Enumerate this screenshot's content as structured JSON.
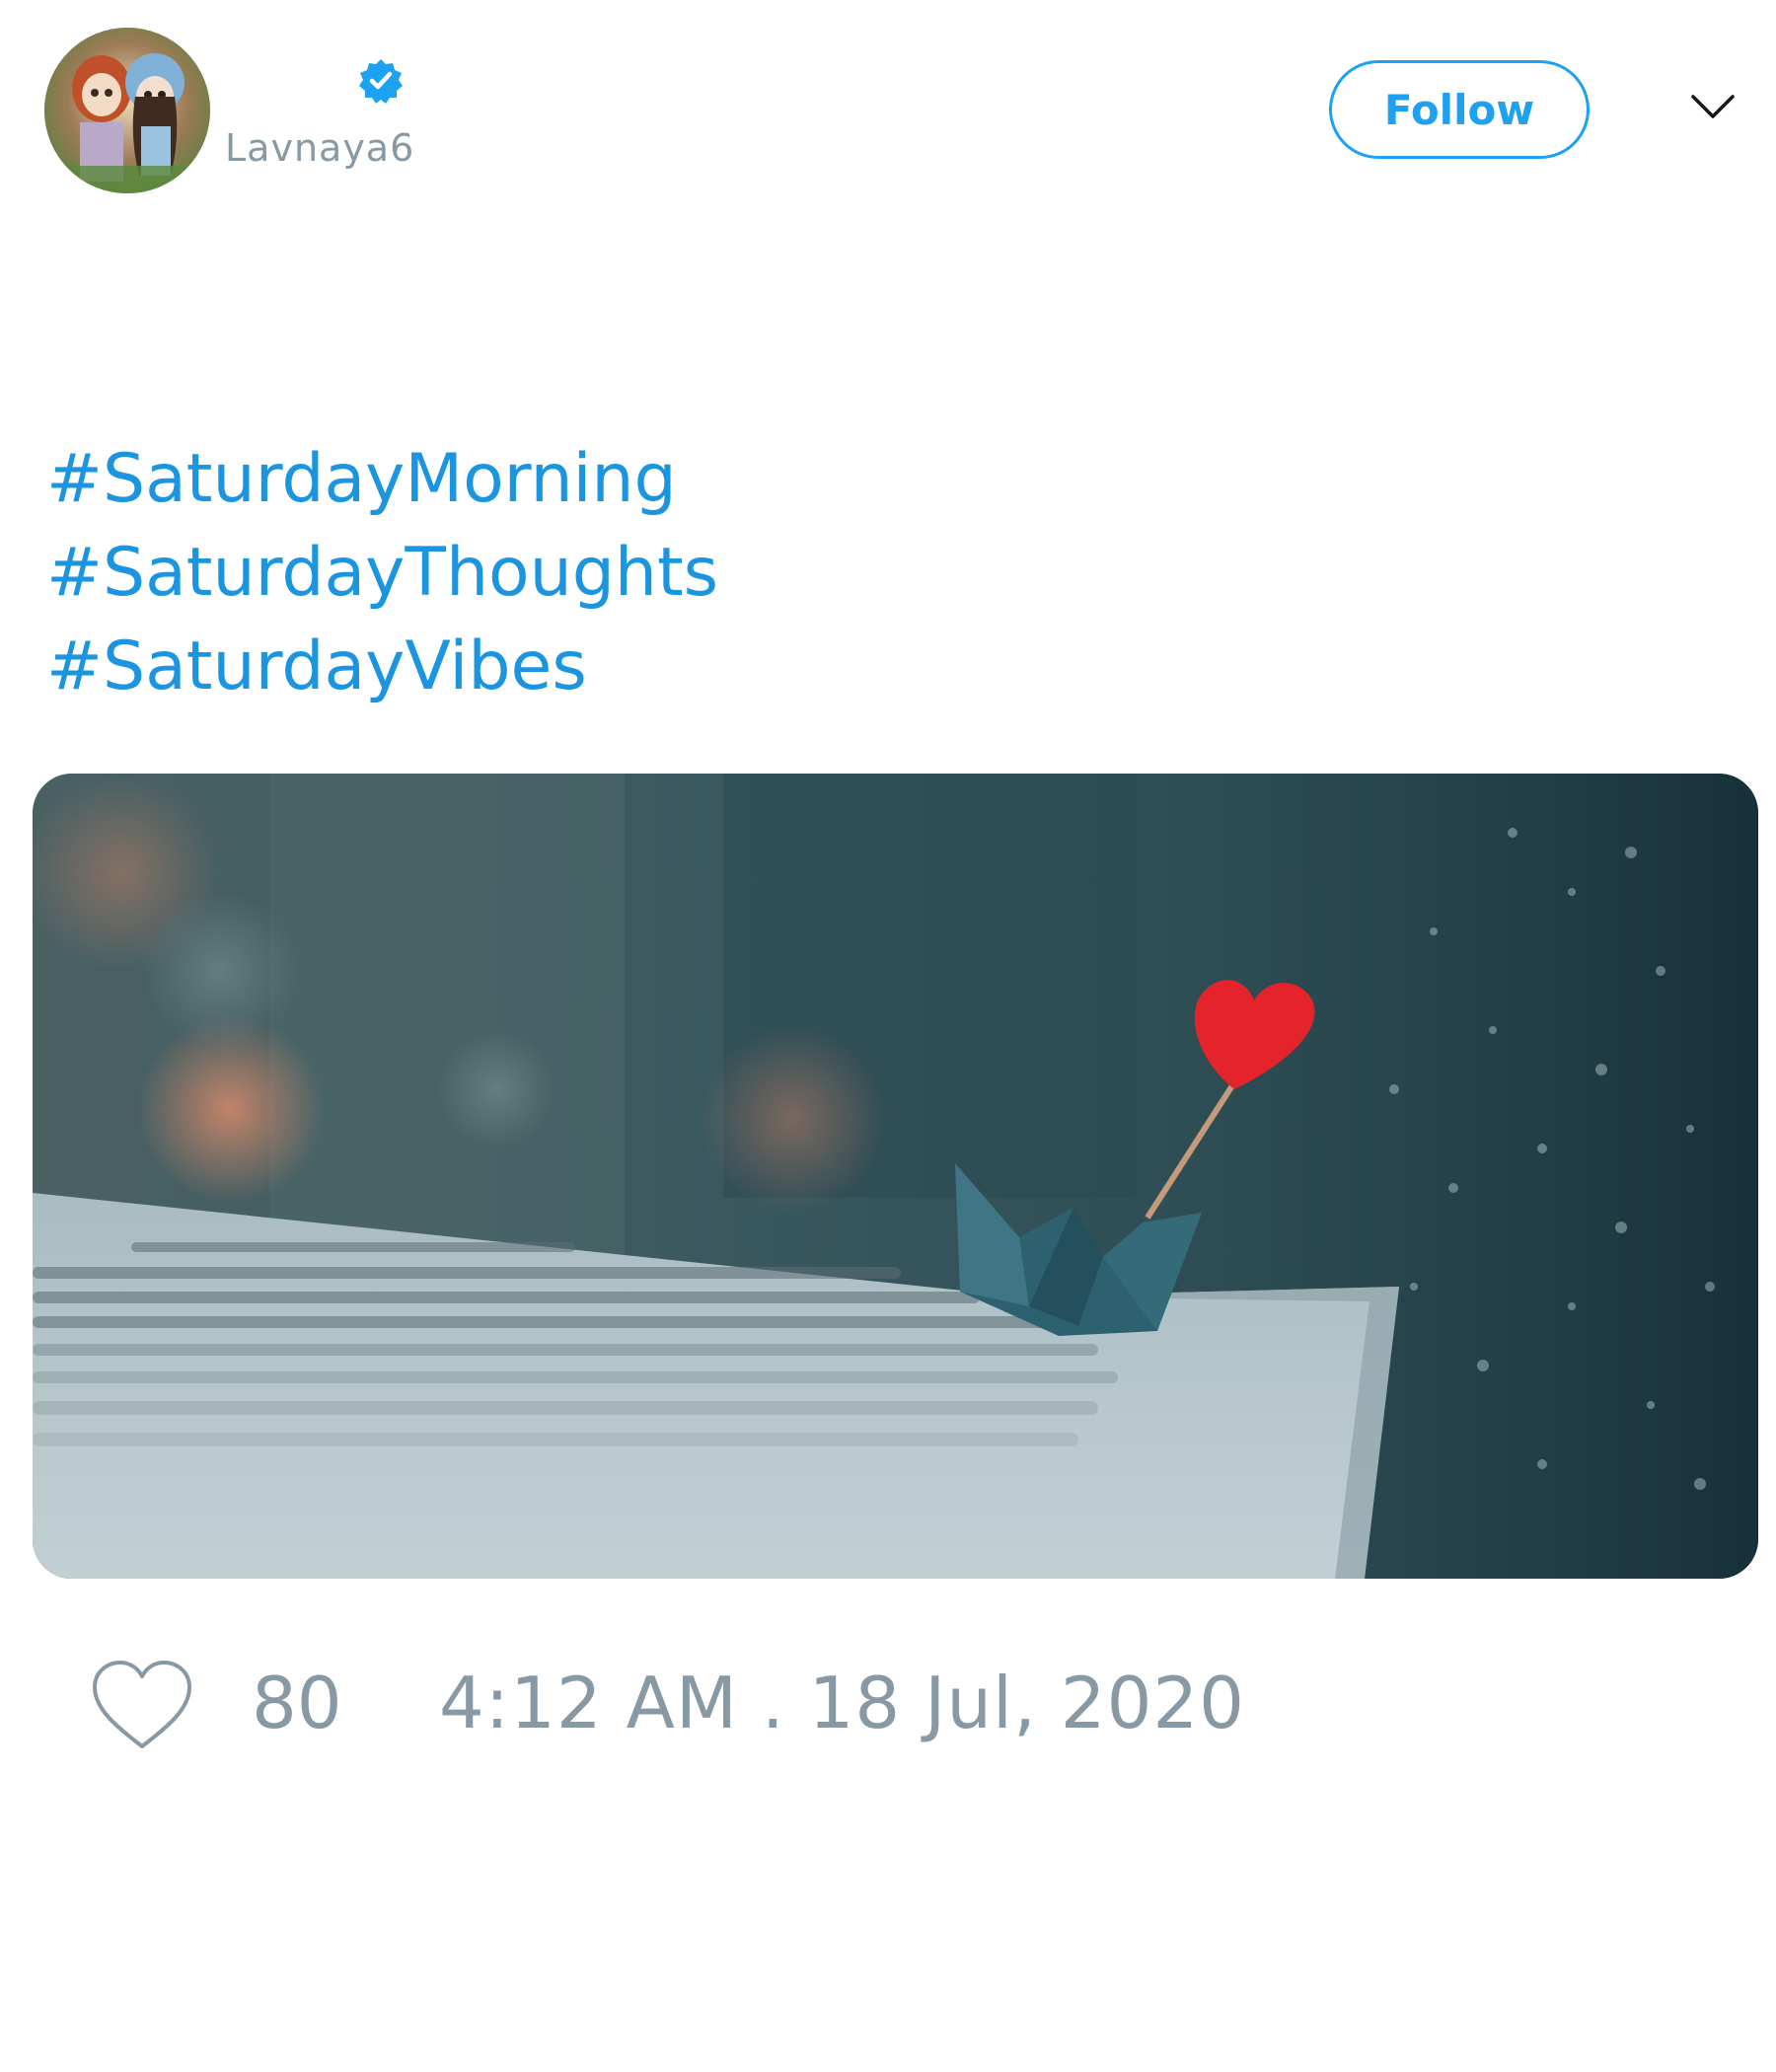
{
  "tweet": {
    "user": {
      "handle": "Lavnaya6",
      "verified": true
    },
    "follow_label": "Follow",
    "hashtags": [
      "#SaturdayMorning",
      "#SaturdayThoughts",
      "#SaturdayVibes"
    ],
    "likes": "80",
    "timestamp": "4:12 AM . 18 Jul, 2020"
  },
  "colors": {
    "accent": "#1da1f2",
    "hashtag": "#1b95e0",
    "muted": "#8899a6"
  },
  "icons": {
    "verified": "verified-badge-icon",
    "caret": "chevron-down-icon",
    "like": "heart-outline-icon"
  }
}
